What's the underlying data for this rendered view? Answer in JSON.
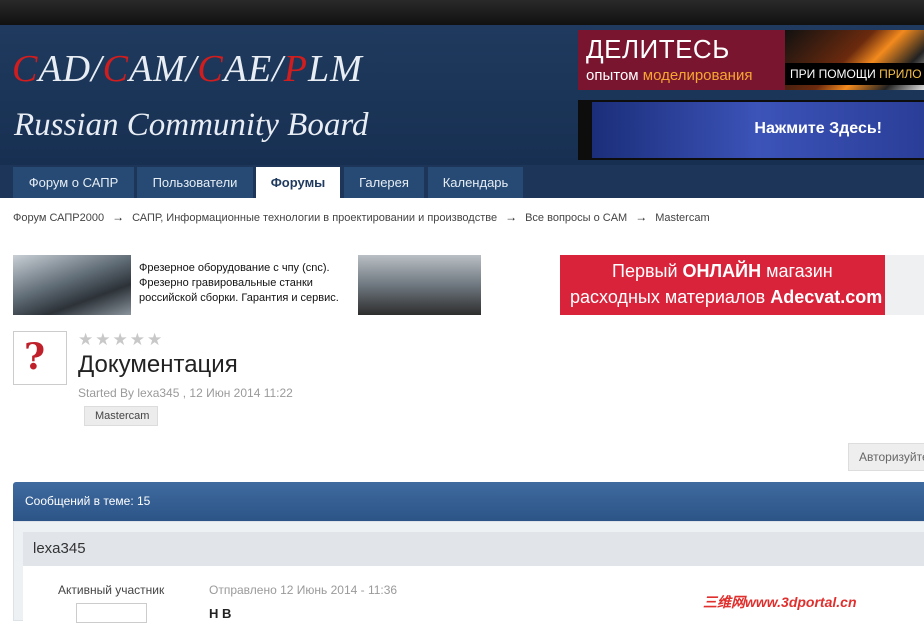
{
  "header": {
    "logo_line1_parts": [
      "C",
      "AD/",
      "C",
      "AM/",
      "C",
      "AE/",
      "P",
      "LM"
    ],
    "logo_line2": "Russian Community Board"
  },
  "ads": {
    "ad1": {
      "big": "ДЕЛИТЕСЬ",
      "small_pre": "опытом ",
      "small_hl": "моделирования",
      "right_pre": "ПРИ ПОМОЩИ ",
      "right_hl": "ПРИЛО"
    },
    "ad2": {
      "text": "Нажмите Здесь!"
    }
  },
  "nav": {
    "tabs": [
      {
        "label": "Форум о САПР",
        "active": false
      },
      {
        "label": "Пользователи",
        "active": false
      },
      {
        "label": "Форумы",
        "active": true
      },
      {
        "label": "Галерея",
        "active": false
      },
      {
        "label": "Календарь",
        "active": false
      }
    ]
  },
  "breadcrumbs": [
    "Форум САПР2000",
    "САПР, Информационные технологии в проектировании и производстве",
    "Все вопросы о CAM",
    "Mastercam"
  ],
  "breadcrumb_sep": "→",
  "banner1": {
    "lines": [
      "Фрезерное оборудование с чпу (cnc).",
      "Фрезерно гравировальные станки",
      "российской сборки. Гарантия и сервис."
    ]
  },
  "banner2": {
    "l1_pre": "Первый ",
    "l1_b": "ОНЛАЙН",
    "l1_post": " магазин",
    "l2_pre": "расходных материалов ",
    "l2_b": "Adecvat.com"
  },
  "topic": {
    "stars": "★★★★★",
    "title": "Документация",
    "started": "Started By lexa345 , 12 Июн 2014 11:22",
    "tag": "Mastercam"
  },
  "auth_button": "Авторизуйте",
  "posts_count_label": "Сообщений в теме: 15",
  "post": {
    "author": "lexa345",
    "role": "Активный участник",
    "sent": "Отправлено 12 Июнь 2014 - 11:36",
    "body_start": "Н   В"
  },
  "watermark": "三维网www.3dportal.cn",
  "colors": {
    "accent_red": "#d11d1d",
    "nav_bg": "#1c3558",
    "header_bg": "#1f3a5e"
  }
}
